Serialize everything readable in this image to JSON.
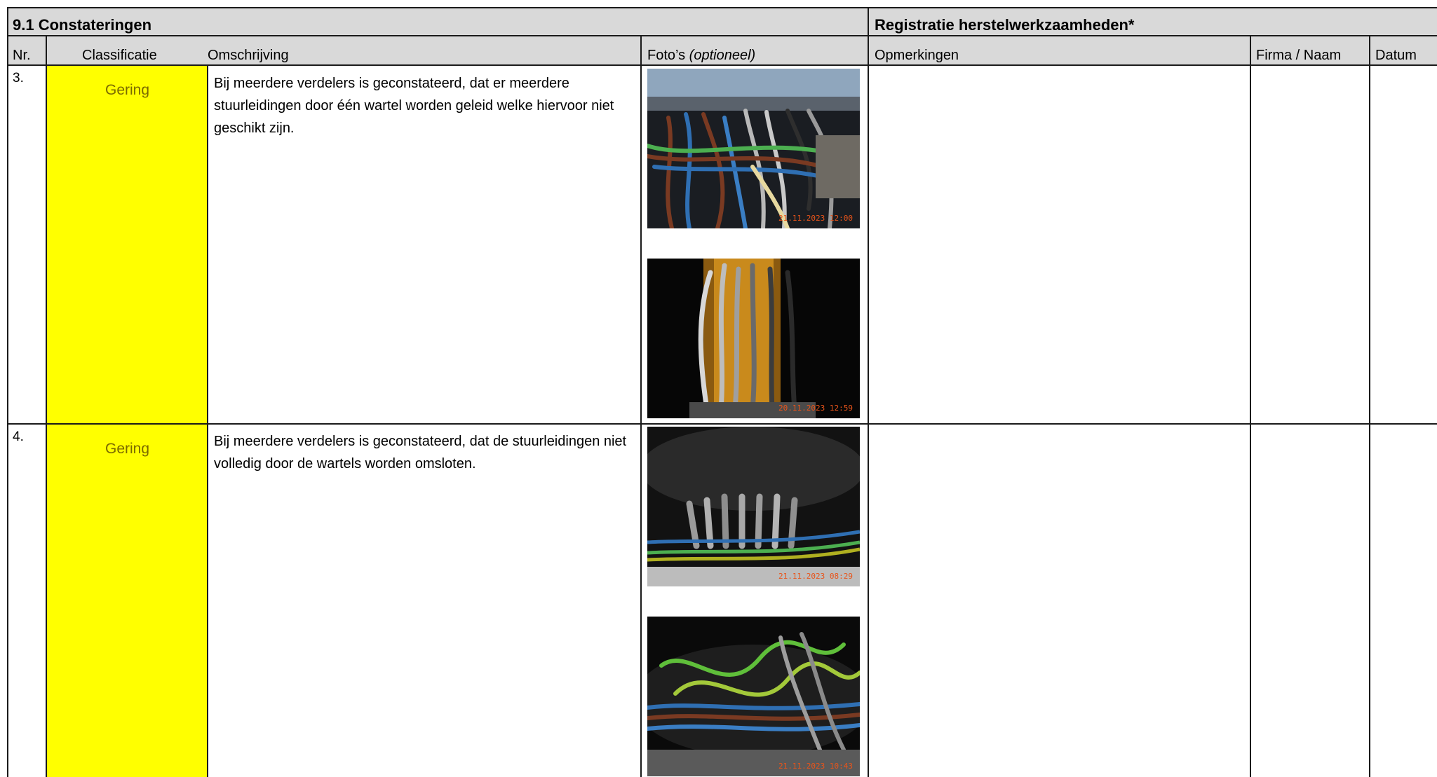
{
  "sections": {
    "left_title": "9.1 Constateringen",
    "right_title": "Registratie herstelwerkzaamheden*"
  },
  "columns": {
    "nr": "Nr.",
    "classificatie": "Classificatie",
    "omschrijving": "Omschrijving",
    "fotos": "Foto’s",
    "fotos_note": "(optioneel)",
    "opmerkingen": "Opmerkingen",
    "firma": "Firma / Naam",
    "datum": "Datum"
  },
  "rows": [
    {
      "nr": "3.",
      "classificatie": "Gering",
      "omschrijving": "Bij meerdere verdelers is geconstateerd, dat er meerdere stuurleidingen door één wartel worden geleid welke hiervoor niet geschikt zijn.",
      "photos": [
        {
          "stamp": "21.11.2023 12:00"
        },
        {
          "stamp": "20.11.2023 12:59"
        }
      ]
    },
    {
      "nr": "4.",
      "classificatie": "Gering",
      "omschrijving": "Bij meerdere verdelers is geconstateerd, dat de stuurleidingen niet volledig door de wartels worden omsloten.",
      "photos": [
        {
          "stamp": "21.11.2023 08:29"
        },
        {
          "stamp": "21.11.2023 10:43"
        }
      ]
    }
  ],
  "colors": {
    "classification_fill": "#ffff00",
    "classification_text": "#7a6a00",
    "header_fill": "#d9d9d9",
    "stamp_text": "#e8541a"
  }
}
